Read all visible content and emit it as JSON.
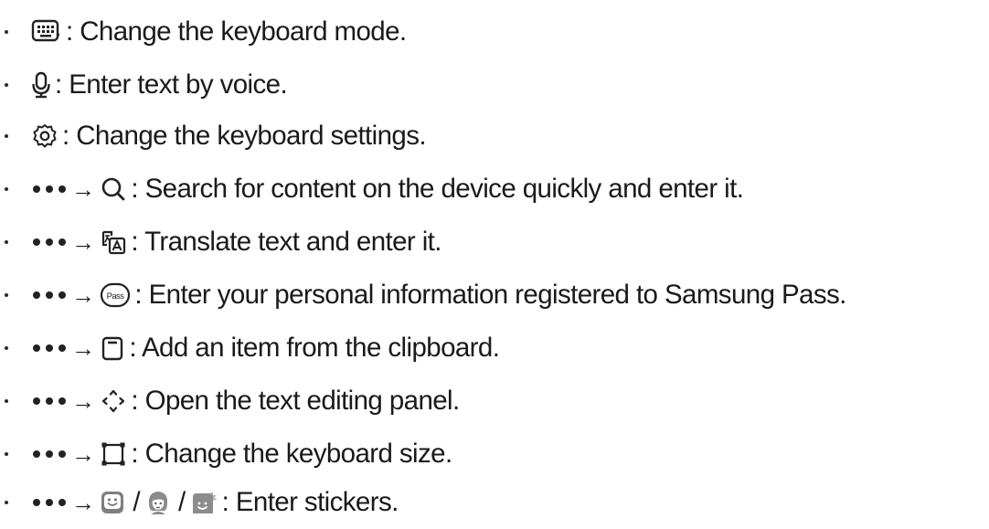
{
  "items": [
    {
      "icon": "keyboard-icon",
      "text": ": Change the keyboard mode."
    },
    {
      "icon": "microphone-icon",
      "text": ": Enter text by voice."
    },
    {
      "icon": "gear-icon",
      "text": ": Change the keyboard settings."
    },
    {
      "icon": "search-icon",
      "text": ": Search for content on the device quickly and enter it."
    },
    {
      "icon": "translate-icon",
      "text": ": Translate text and enter it."
    },
    {
      "icon": "samsung-pass-icon",
      "icon_text": "Pass",
      "text": ": Enter your personal information registered to Samsung Pass."
    },
    {
      "icon": "clipboard-icon",
      "text": ": Add an item from the clipboard."
    },
    {
      "icon": "text-editing-icon",
      "text": ": Open the text editing panel."
    },
    {
      "icon": "keyboard-size-icon",
      "text": ": Change the keyboard size."
    },
    {
      "icons": [
        "sticker-icon",
        "ar-emoji-icon",
        "bitmoji-icon"
      ],
      "separator": "/",
      "text": ": Enter stickers."
    }
  ],
  "arrow": "→"
}
